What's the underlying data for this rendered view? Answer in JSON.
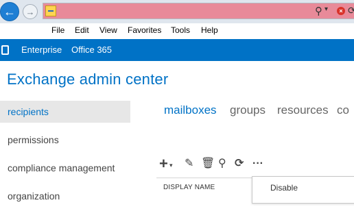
{
  "browser": {
    "address_color": "#e88a99"
  },
  "menubar": {
    "items": [
      "File",
      "Edit",
      "View",
      "Favorites",
      "Tools",
      "Help"
    ]
  },
  "o365_nav": {
    "links": [
      "Enterprise",
      "Office 365"
    ],
    "brand_color": "#0072c6"
  },
  "app": {
    "title": "Exchange admin center"
  },
  "leftnav": {
    "items": [
      "recipients",
      "permissions",
      "compliance management",
      "organization"
    ],
    "selected": "recipients"
  },
  "tabs": {
    "items": [
      "mailboxes",
      "groups",
      "resources",
      "co"
    ],
    "selected": "mailboxes"
  },
  "toolbar": {
    "icons": [
      "add-icon",
      "edit-icon",
      "delete-icon",
      "search-icon",
      "refresh-icon",
      "more-icon"
    ]
  },
  "grid": {
    "column_header": "DISPLAY NAME"
  },
  "popup": {
    "item": "Disable"
  }
}
